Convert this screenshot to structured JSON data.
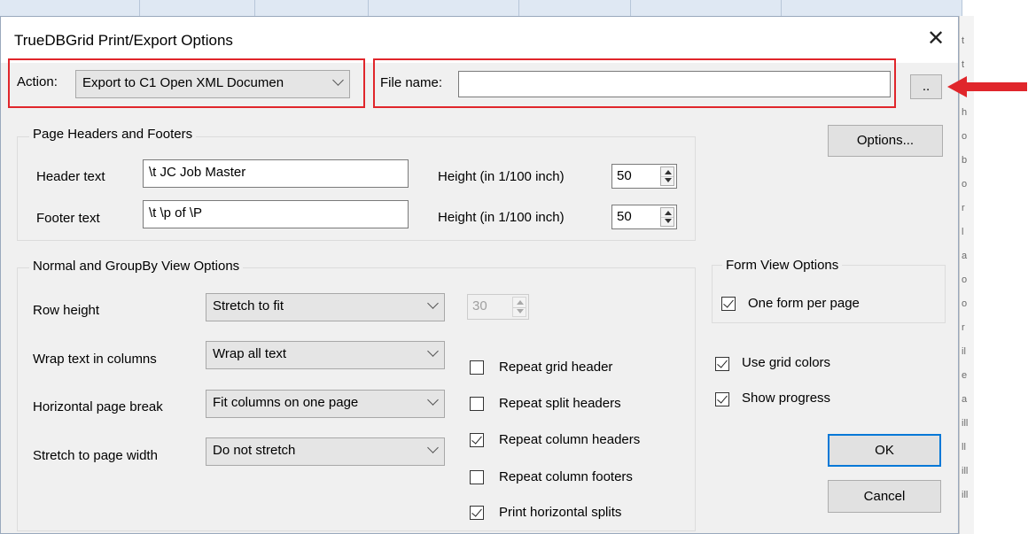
{
  "dialog": {
    "title": "TrueDBGrid Print/Export Options",
    "close_glyph": "✕"
  },
  "action": {
    "label": "Action:",
    "selected": "Export to C1 Open XML Documen"
  },
  "file": {
    "label": "File name:",
    "value": "",
    "browse_label": ".."
  },
  "options_button": "Options...",
  "headers_footers": {
    "title": "Page Headers and Footers",
    "header_label": "Header text",
    "header_value": "\\t JC Job Master",
    "footer_label": "Footer text",
    "footer_value": "\\t \\p of \\P",
    "height_label_1": "Height (in 1/100 inch)",
    "height_value_1": "50",
    "height_label_2": "Height (in 1/100 inch)",
    "height_value_2": "50"
  },
  "view_options": {
    "title": "Normal and GroupBy View Options",
    "row_height_label": "Row height",
    "row_height_value": "Stretch to fit",
    "row_height_number": "30",
    "wrap_label": "Wrap text in columns",
    "wrap_value": "Wrap all text",
    "hbreak_label": "Horizontal page break",
    "hbreak_value": "Fit columns on one page",
    "stretch_label": "Stretch to page width",
    "stretch_value": "Do not stretch"
  },
  "checkboxes": [
    {
      "label": "Repeat grid header",
      "checked": false
    },
    {
      "label": "Repeat split headers",
      "checked": false
    },
    {
      "label": "Repeat column headers",
      "checked": true
    },
    {
      "label": "Repeat column footers",
      "checked": false
    },
    {
      "label": "Print horizontal splits",
      "checked": true
    }
  ],
  "form_view": {
    "title": "Form View Options",
    "one_form": {
      "label": "One form per page",
      "checked": true
    }
  },
  "right_checks": [
    {
      "label": "Use grid colors",
      "checked": true
    },
    {
      "label": "Show progress",
      "checked": true
    }
  ],
  "ok_label": "OK",
  "cancel_label": "Cancel",
  "colors": {
    "highlight_box": "#e0262b",
    "default_button_border": "#0078d7",
    "annotation_arrow": "#e0262b"
  },
  "icons": {
    "annotation": "red-arrow-left-icon",
    "close": "close-icon",
    "dropdown": "chevron-down-icon",
    "check": "checkmark-icon"
  },
  "background_fragments": [
    "t",
    "t",
    "a",
    "h",
    "o",
    "b",
    "o",
    "r",
    "l",
    "a",
    "o",
    "o",
    "r",
    "il",
    "e",
    "a",
    "ill",
    "ll",
    "ill",
    "ill"
  ]
}
